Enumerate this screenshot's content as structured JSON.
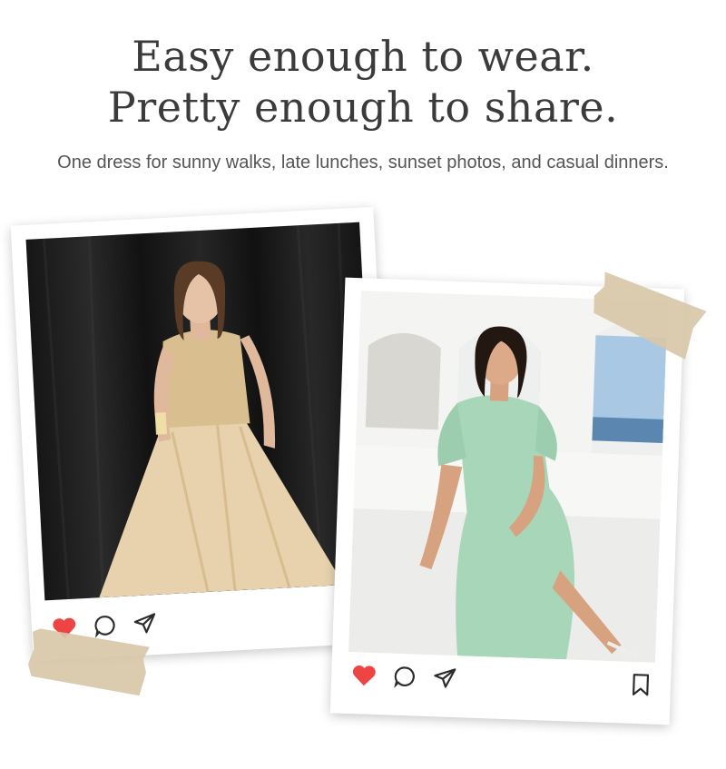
{
  "headline": {
    "line1": "Easy enough to wear.",
    "line2": "Pretty enough to share."
  },
  "subheadline": "One dress for sunny walks, late lunches, sunset photos, and casual dinners.",
  "posts": [
    {
      "photo": "woman-in-gold-embellished-tulle-dress",
      "icons": [
        "heart-icon",
        "comment-icon",
        "share-icon",
        "bookmark-icon"
      ]
    },
    {
      "photo": "woman-in-mint-green-midi-dress",
      "icons": [
        "heart-icon",
        "comment-icon",
        "share-icon",
        "bookmark-icon"
      ]
    }
  ],
  "colors": {
    "heart": "#ef4444",
    "icon_stroke": "#2b2b2b",
    "tape": "#d8c7a8",
    "gold_dress": "#e6cfa4",
    "mint_dress": "#a8d6b8"
  }
}
